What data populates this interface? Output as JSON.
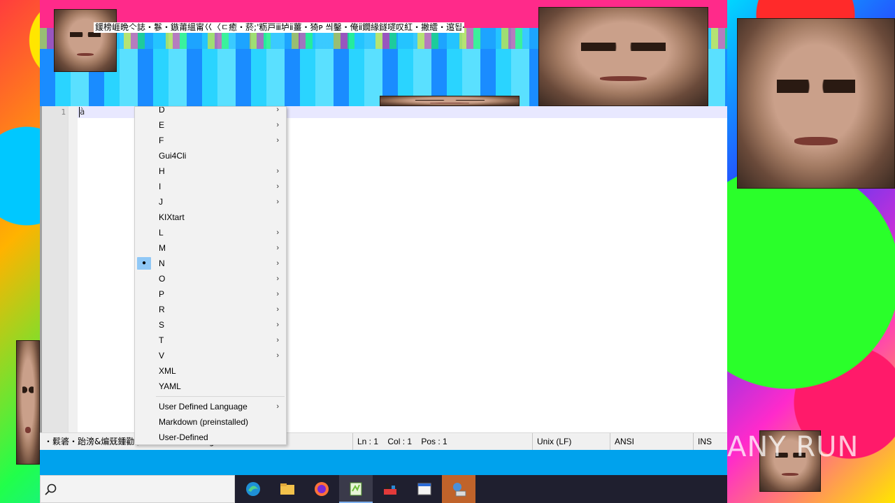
{
  "corrupted_title": "鍰榜崕晩亽誌・鬖・鏃莆縕甯巜〈ㄷ癒・菸;'粝戸ⅲ垆ⅱ薑・猗ᴩ 씌鑿・俺ⅱ鐗緣鐩嚃叹紅・撇繧・逭됩ᆖ긺ᆖ",
  "editor": {
    "line_number": "1",
    "content": "à"
  },
  "menu": {
    "items": [
      {
        "label": "D",
        "submenu": true
      },
      {
        "label": "E",
        "submenu": true
      },
      {
        "label": "F",
        "submenu": true
      },
      {
        "label": "Gui4Cli",
        "submenu": false
      },
      {
        "label": "H",
        "submenu": true
      },
      {
        "label": "I",
        "submenu": true
      },
      {
        "label": "J",
        "submenu": true
      },
      {
        "label": "KIXtart",
        "submenu": false
      },
      {
        "label": "L",
        "submenu": true
      },
      {
        "label": "M",
        "submenu": true
      },
      {
        "label": "N",
        "submenu": true,
        "checked": true
      },
      {
        "label": "O",
        "submenu": true
      },
      {
        "label": "P",
        "submenu": true
      },
      {
        "label": "R",
        "submenu": true
      },
      {
        "label": "S",
        "submenu": true
      },
      {
        "label": "T",
        "submenu": true
      },
      {
        "label": "V",
        "submenu": true
      },
      {
        "label": "XML",
        "submenu": false
      },
      {
        "label": "YAML",
        "submenu": false
      }
    ],
    "extra_items": [
      {
        "label": "User Defined Language",
        "submenu": true
      },
      {
        "label": "Markdown (preinstalled)",
        "submenu": false
      },
      {
        "label": "User-Defined",
        "submenu": false
      }
    ],
    "arrow_glyph": "›",
    "check_glyph": "●"
  },
  "statusbar": {
    "left_text": "・鬏碆・跆滂&煸兓鍾勸隳",
    "left_tail": "g",
    "position": "Ln : 1    Col : 1    Pos : 1",
    "eol": "Unix (LF)",
    "encoding": "ANSI",
    "insert_mode": "INS"
  },
  "taskbar": {
    "search_icon": "search-icon",
    "apps": [
      {
        "name": "edge-icon",
        "color": "#1e90d6"
      },
      {
        "name": "file-explorer-icon",
        "color": "#f2c14b"
      },
      {
        "name": "firefox-icon",
        "color": "#ff7139"
      },
      {
        "name": "notepad-plus-plus-icon",
        "color": "#6fbf3a",
        "active": true
      },
      {
        "name": "tool-icon",
        "color": "#e23a3a"
      },
      {
        "name": "window-icon",
        "color": "#d8d8d8"
      },
      {
        "name": "network-icon",
        "color": "#4a90d9",
        "highlighted": true
      }
    ]
  },
  "watermark": "ANY RUN"
}
